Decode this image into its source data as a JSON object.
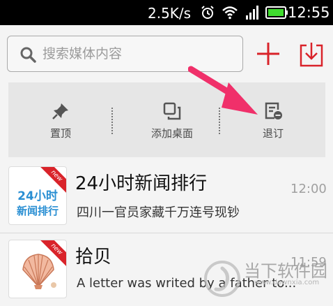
{
  "status_bar": {
    "speed": "2.5K/s",
    "time": "12:55",
    "icons": [
      "alarm-icon",
      "wifi-icon",
      "signal-icon",
      "battery-icon"
    ]
  },
  "search": {
    "placeholder": "搜索媒体内容"
  },
  "toolbar": {
    "icons": [
      "add-icon",
      "download-icon"
    ]
  },
  "actions": {
    "pin_label": "置顶",
    "desktop_label": "添加桌面",
    "unsubscribe_label": "退订"
  },
  "list": [
    {
      "title": "24小时新闻排行",
      "subtitle": "四川一官员家藏千万连号现钞",
      "time": "12:00",
      "thumb_line1": "24小时",
      "thumb_line2": "新闻排行",
      "badge": "new"
    },
    {
      "title": "拾贝",
      "subtitle": "A letter was writed by a father to...",
      "time": "11:59",
      "badge": "new"
    }
  ],
  "watermark": {
    "text": "当下软件园",
    "url": "www.downxia.com"
  },
  "colors": {
    "accent": "#d9232a",
    "arrow": "#f0306a",
    "thumb_text": "#2a8fd3"
  }
}
